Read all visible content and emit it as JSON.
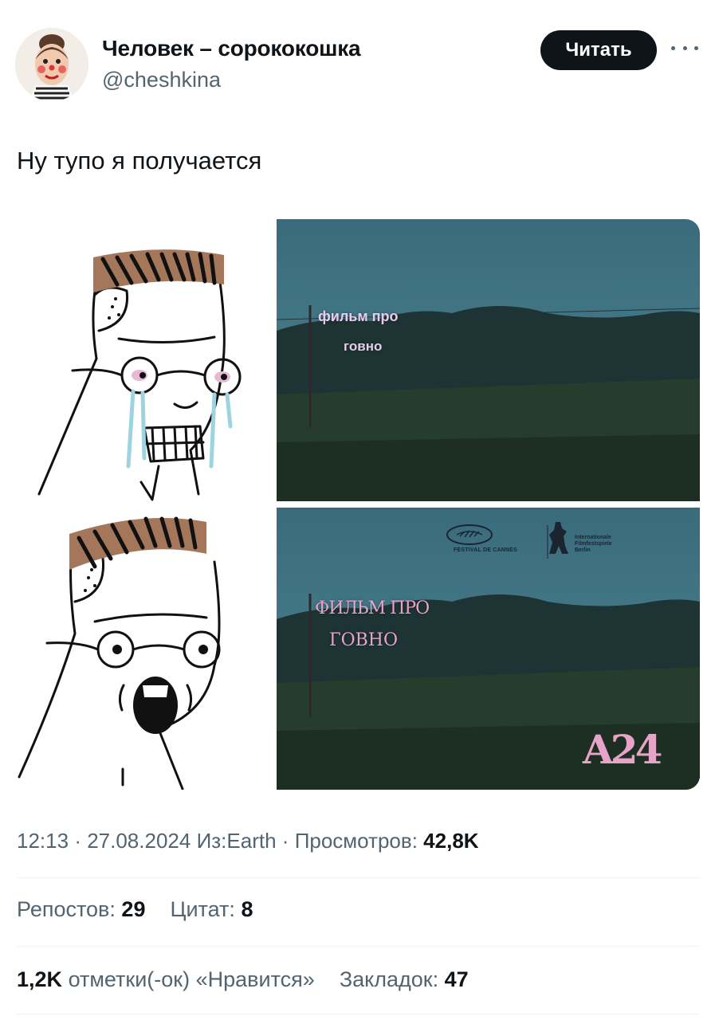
{
  "author": {
    "name": "Человек – сорококошка",
    "handle": "@cheshkina"
  },
  "follow_button_label": "Читать",
  "tweet_text": "Ну тупо я получается",
  "media": {
    "top_caption_line1": "фильм про",
    "top_caption_line2": "говно",
    "bottom_caption_line1": "ФИЛЬМ ПРО",
    "bottom_caption_line2": "ГОВНО",
    "cannes_label": "FESTIVAL DE CANNES",
    "berlin_label": "Internationale\nFilmfestspiele\nBerlin",
    "studio_logo": "A24"
  },
  "meta": {
    "time": "12:13",
    "date": "27.08.2024",
    "source": "Из:Earth",
    "views_label": "Просмотров:",
    "views_value": "42,8K"
  },
  "stats": {
    "reposts_label": "Репостов:",
    "reposts_value": "29",
    "quotes_label": "Цитат:",
    "quotes_value": "8",
    "likes_value": "1,2K",
    "likes_label": "отметки(-ок) «Нравится»",
    "bookmarks_label": "Закладок:",
    "bookmarks_value": "47"
  },
  "colors": {
    "accent_dark": "#0f1419",
    "secondary_text": "#536471",
    "divider": "#eff3f4",
    "sky": "#3b6d7e",
    "caption_pink": "#e8a3c8"
  }
}
